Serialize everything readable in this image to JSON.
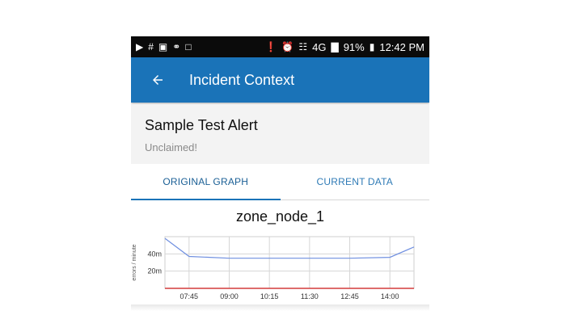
{
  "status_bar": {
    "left_icons": [
      "play-store-icon",
      "slack-icon",
      "image-icon",
      "key-icon",
      "calendar-icon"
    ],
    "right_icons": [
      "bluetooth-icon",
      "alarm-icon",
      "wifi-icon",
      "lte-icon",
      "signal-icon",
      "battery-icon"
    ],
    "battery": "91%",
    "time": "12:42 PM",
    "network": "4G"
  },
  "app_bar": {
    "title": "Incident Context",
    "back_icon": "arrow-back-icon"
  },
  "alert": {
    "title": "Sample Test Alert",
    "status": "Unclaimed!"
  },
  "tabs": [
    {
      "label": "ORIGINAL GRAPH",
      "active": true
    },
    {
      "label": "CURRENT DATA",
      "active": false
    }
  ],
  "graph": {
    "title": "zone_node_1"
  },
  "colors": {
    "primary": "#1a73b8",
    "series_blue": "#6f8fe0",
    "threshold_red": "#d43c3c"
  },
  "chart_data": {
    "type": "line",
    "ylabel": "errors / minute",
    "xlabel": "",
    "x_ticks": [
      "07:45",
      "09:00",
      "10:15",
      "11:30",
      "12:45",
      "14:00"
    ],
    "y_ticks": [
      "40m",
      "20m"
    ],
    "ylim": [
      0,
      60
    ],
    "grid": true,
    "series": [
      {
        "x": [
          "07:00",
          "07:45",
          "09:00",
          "10:15",
          "11:30",
          "12:45",
          "14:00",
          "14:45"
        ],
        "values": [
          58,
          37,
          35,
          35,
          35,
          35,
          36,
          48
        ],
        "color": "#6f8fe0"
      },
      {
        "x": [
          "07:00",
          "14:45"
        ],
        "values": [
          0,
          0
        ],
        "color": "#d43c3c"
      }
    ]
  }
}
